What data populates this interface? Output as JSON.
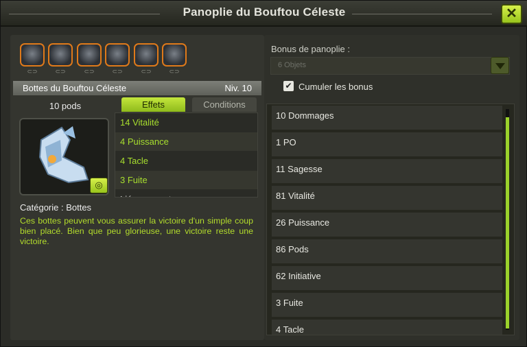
{
  "window": {
    "title": "Panoplie du Bouftou Céleste",
    "close_label": "✕"
  },
  "item_slots": [
    {
      "icon": "helmet-icon"
    },
    {
      "icon": "cape-icon"
    },
    {
      "icon": "belt-icon"
    },
    {
      "icon": "amulet-icon"
    },
    {
      "icon": "boots-icon"
    },
    {
      "icon": "ring-icon"
    }
  ],
  "slot_link_glyph": "⊂⊃",
  "item": {
    "name": "Bottes du Bouftou Céleste",
    "level": "Niv. 10",
    "pods": "10 pods",
    "category": "Catégorie : Bottes",
    "description": "Ces bottes peuvent vous assurer la victoire d'un simple coup bien placé. Bien que peu glorieuse, une victoire reste une victoire.",
    "img_button": "◎"
  },
  "tabs": {
    "effects": "Effets",
    "conditions": "Conditions"
  },
  "effects": [
    "14 Vitalité",
    "4 Puissance",
    "4 Tacle",
    "3 Fuite",
    "Lié au compte"
  ],
  "set_bonus": {
    "label": "Bonus de panoplie :",
    "selected": "6 Objets",
    "cumulate_label": "Cumuler les bonus",
    "cumulate_checked": "✔",
    "items": [
      "10 Dommages",
      "1 PO",
      "11 Sagesse",
      "81 Vitalité",
      "26 Puissance",
      "86 Pods",
      "62 Initiative",
      "3 Fuite",
      "4 Tacle"
    ]
  },
  "colors": {
    "accent": "#a8df2e",
    "slot_border": "#e07a1a"
  }
}
